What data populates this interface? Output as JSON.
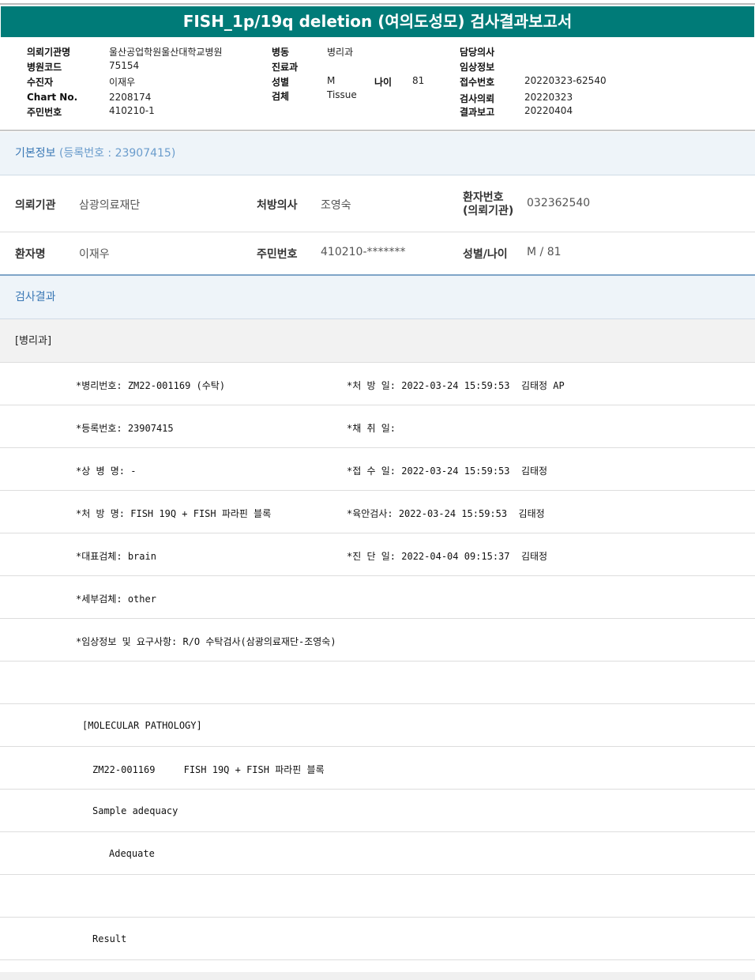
{
  "title": "FISH_1p/19q deletion (여의도성모) 검사결과보고서",
  "info": {
    "col1": [
      {
        "label": "의뢰기관명",
        "value": "울산공업학원울산대학교병원"
      },
      {
        "label": "병원코드",
        "value": "75154"
      },
      {
        "label": "수진자",
        "value": "이재우"
      },
      {
        "label": "Chart No.",
        "value": "2208174"
      },
      {
        "label": "주민번호",
        "value": "410210-1"
      }
    ],
    "col2": [
      {
        "label": "병동",
        "value": "병리과"
      },
      {
        "label": "진료과",
        "value": ""
      },
      {
        "label": "성별",
        "value": "M"
      },
      {
        "label": "검체",
        "value": "Tissue"
      }
    ],
    "age_label": "나이",
    "age_value": "81",
    "col3": [
      {
        "label": "담당의사",
        "value": ""
      },
      {
        "label": "임상정보",
        "value": ""
      },
      {
        "label": "접수번호",
        "value": "20220323-62540"
      },
      {
        "label": "검사의뢰",
        "value": "20220323"
      },
      {
        "label": "결과보고",
        "value": "20220404"
      }
    ]
  },
  "basic": {
    "title": "기본정보",
    "subtitle": "(등록번호 : 23907415)",
    "institution_label": "의뢰기관",
    "institution": "삼광의료재단",
    "doctor_label": "처방의사",
    "doctor": "조영숙",
    "patient_no_label1": "환자번호",
    "patient_no_label2": "(의뢰기관)",
    "patient_no": "032362540",
    "name_label": "환자명",
    "name": "이재우",
    "rrn_label": "주민번호",
    "rrn": "410210-*******",
    "sexage_label": "성별/나이",
    "sexage": "M / 81"
  },
  "results": {
    "title": "검사결과",
    "dept": "[병리과]",
    "rows": [
      {
        "left": "*병리번호: ZM22-001169 (수탁)",
        "right": "*처 방 일: 2022-03-24 15:59:53  김태정 AP"
      },
      {
        "left": "*등록번호: 23907415",
        "right": "*채 취 일:"
      },
      {
        "left": "*상 병 명: -",
        "right": "*접 수 일: 2022-03-24 15:59:53  김태정"
      },
      {
        "left": "*처 방 명: FISH 19Q + FISH 파라핀 블록",
        "right": "*육안검사: 2022-03-24 15:59:53  김태정"
      },
      {
        "left": "*대표검체: brain",
        "right": "*진 단 일: 2022-04-04 09:15:37  김태정"
      },
      {
        "left": "*세부검체: other",
        "right": ""
      },
      {
        "left": "*임상정보 및 요구사항: R/O 수탁검사(삼광의료재단-조영숙)",
        "right": ""
      }
    ],
    "report": [
      "",
      "[MOLECULAR PATHOLOGY]",
      "ZM22-001169     FISH 19Q + FISH 파라핀 블록",
      "Sample adequacy",
      "Adequate",
      "",
      "Result"
    ]
  }
}
